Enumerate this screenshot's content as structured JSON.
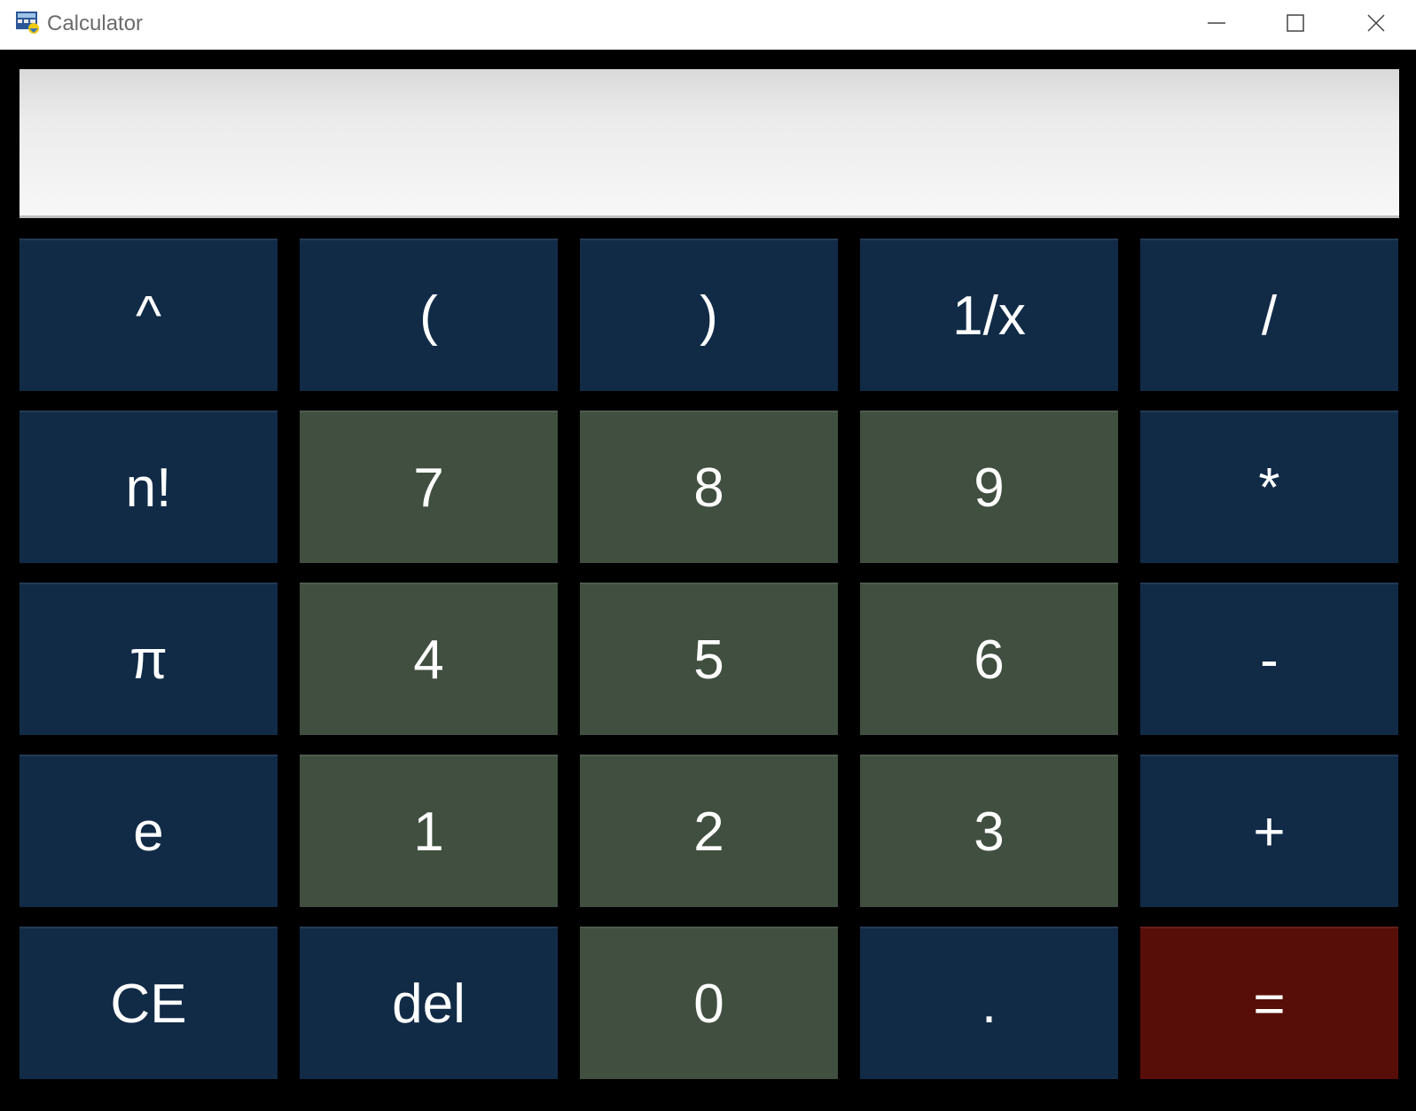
{
  "window": {
    "title": "Calculator",
    "controls": {
      "minimize": "minimize",
      "maximize": "maximize",
      "close": "close"
    }
  },
  "display": {
    "value": ""
  },
  "colors": {
    "operator_key": "#112b47",
    "digit_key": "#404f40",
    "equals_key": "#580e08",
    "display_bg": "#f0f0f0"
  },
  "keys": [
    {
      "label": "^",
      "kind": "op",
      "name": "power-button"
    },
    {
      "label": "(",
      "kind": "op",
      "name": "open-paren-button"
    },
    {
      "label": ")",
      "kind": "op",
      "name": "close-paren-button"
    },
    {
      "label": "1/x",
      "kind": "op",
      "name": "reciprocal-button"
    },
    {
      "label": "/",
      "kind": "op",
      "name": "divide-button"
    },
    {
      "label": "n!",
      "kind": "op",
      "name": "factorial-button"
    },
    {
      "label": "7",
      "kind": "num",
      "name": "digit-7-button"
    },
    {
      "label": "8",
      "kind": "num",
      "name": "digit-8-button"
    },
    {
      "label": "9",
      "kind": "num",
      "name": "digit-9-button"
    },
    {
      "label": "*",
      "kind": "op",
      "name": "multiply-button"
    },
    {
      "label": "π",
      "kind": "op",
      "name": "pi-button"
    },
    {
      "label": "4",
      "kind": "num",
      "name": "digit-4-button"
    },
    {
      "label": "5",
      "kind": "num",
      "name": "digit-5-button"
    },
    {
      "label": "6",
      "kind": "num",
      "name": "digit-6-button"
    },
    {
      "label": "-",
      "kind": "op",
      "name": "subtract-button"
    },
    {
      "label": "e",
      "kind": "op",
      "name": "euler-button"
    },
    {
      "label": "1",
      "kind": "num",
      "name": "digit-1-button"
    },
    {
      "label": "2",
      "kind": "num",
      "name": "digit-2-button"
    },
    {
      "label": "3",
      "kind": "num",
      "name": "digit-3-button"
    },
    {
      "label": "+",
      "kind": "op",
      "name": "add-button"
    },
    {
      "label": "CE",
      "kind": "op",
      "name": "clear-entry-button"
    },
    {
      "label": "del",
      "kind": "op",
      "name": "delete-button"
    },
    {
      "label": "0",
      "kind": "num",
      "name": "digit-0-button"
    },
    {
      "label": ".",
      "kind": "op",
      "name": "decimal-point-button"
    },
    {
      "label": "=",
      "kind": "eq",
      "name": "equals-button"
    }
  ]
}
